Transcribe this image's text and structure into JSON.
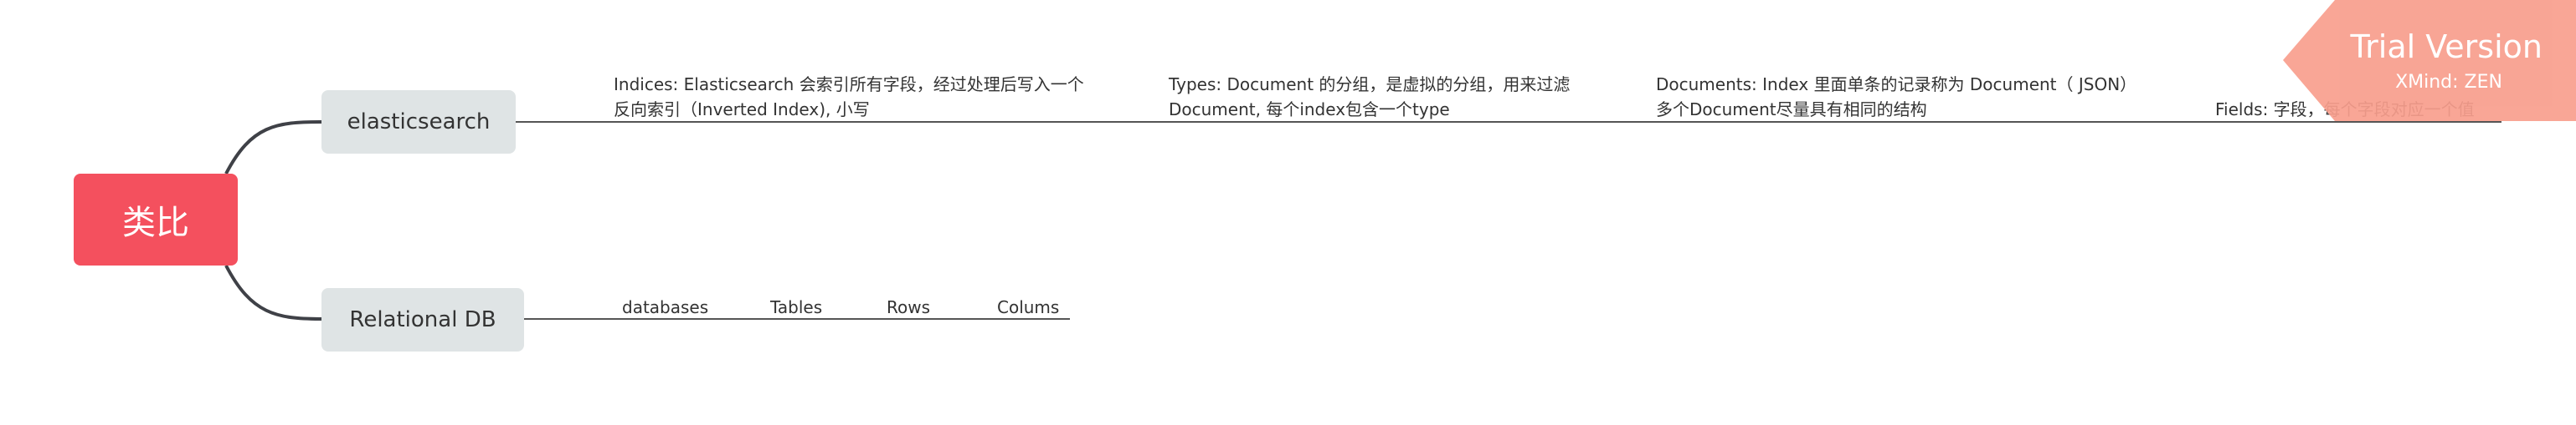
{
  "root": {
    "label": "类比"
  },
  "branches": {
    "elasticsearch": {
      "label": "elasticsearch",
      "children": [
        {
          "line1": "Indices: Elasticsearch 会索引所有字段，经过处理后写入一个",
          "line2": "反向索引（Inverted Index), 小写"
        },
        {
          "line1": "Types: Document 的分组，是虚拟的分组，用来过滤",
          "line2": "Document, 每个index包含一个type"
        },
        {
          "line1": "Documents: Index 里面单条的记录称为 Document（ JSON）",
          "line2": "多个Document尽量具有相同的结构"
        },
        {
          "line1": "",
          "line2": "Fields: 字段，每个字段对应一个值"
        }
      ]
    },
    "relational_db": {
      "label": "Relational DB",
      "children": [
        {
          "label": "databases"
        },
        {
          "label": "Tables"
        },
        {
          "label": "Rows"
        },
        {
          "label": "Colums"
        }
      ]
    }
  },
  "watermark": {
    "title": "Trial Version",
    "subtitle": "XMind: ZEN"
  },
  "colors": {
    "root_fill": "#f4505e",
    "branch_fill": "#dfe4e5",
    "connector": "#4a4a4a",
    "watermark": "#f89e8d"
  }
}
